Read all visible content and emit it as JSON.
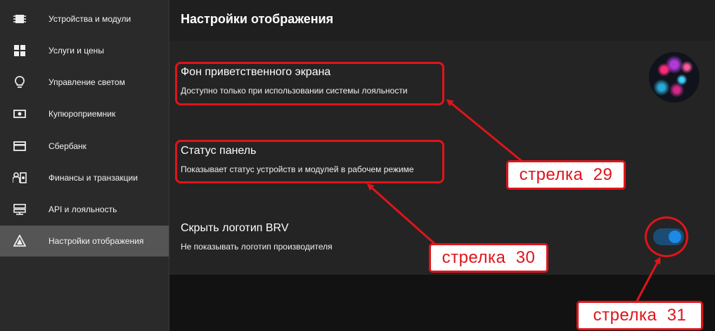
{
  "sidebar": {
    "items": [
      {
        "label": "Устройства и модули",
        "icon": "chip-icon",
        "active": false
      },
      {
        "label": "Услуги и цены",
        "icon": "grid-icon",
        "active": false
      },
      {
        "label": "Управление светом",
        "icon": "lightbulb-icon",
        "active": false
      },
      {
        "label": "Купюроприемник",
        "icon": "banknote-icon",
        "active": false
      },
      {
        "label": "Сбербанк",
        "icon": "credit-card-icon",
        "active": false
      },
      {
        "label": "Финансы и транзакции",
        "icon": "finance-icon",
        "active": false
      },
      {
        "label": "API и лояльность",
        "icon": "api-icon",
        "active": false
      },
      {
        "label": "Настройки отображения",
        "icon": "display-settings-icon",
        "active": true
      }
    ]
  },
  "header": {
    "title": "Настройки отображения"
  },
  "settings": {
    "welcome_bg": {
      "title": "Фон приветственного экрана",
      "description": "Доступно только при использовании системы лояльности"
    },
    "status_panel": {
      "title": "Статус панель",
      "description": "Показывает статус устройств и модулей в рабочем режиме"
    },
    "hide_logo": {
      "title": "Скрыть логотип BRV",
      "description": "Не показывать логотип производителя",
      "enabled": true
    }
  },
  "annotations": {
    "arrow29": "стрелка  29",
    "arrow30": "стрелка  30",
    "arrow31": "стрелка  31"
  },
  "colors": {
    "annotation_red": "#e0141a",
    "toggle_on": "#1e88e5",
    "active_nav": "#555555"
  }
}
